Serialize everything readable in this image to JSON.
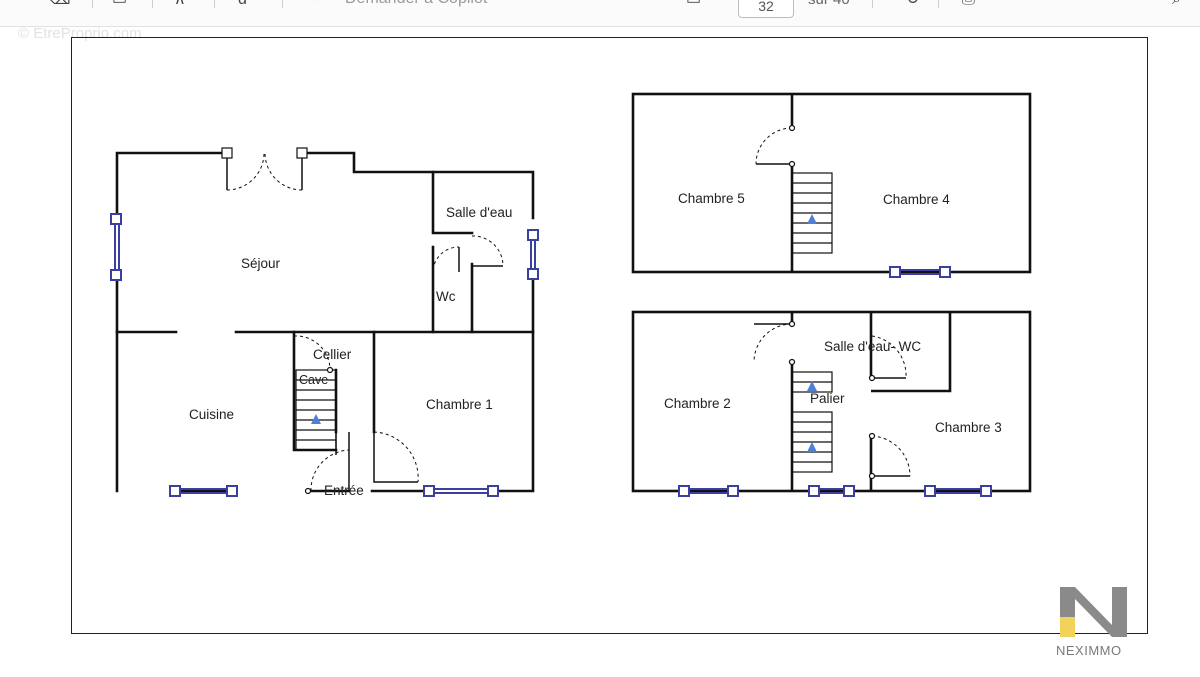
{
  "toolbar": {
    "copilot_label": "Demander à Copilot",
    "current_page": "32",
    "page_total": "sur 40",
    "icons": [
      "eraser-icon",
      "text-box-icon",
      "highlight-icon",
      "read-aloud-icon",
      "copilot-icon",
      "zoom-out-icon",
      "fit-page-icon",
      "rotate-icon",
      "print-icon",
      "search-icon"
    ]
  },
  "watermark": "© EtreProprio.com",
  "rooms": {
    "sejour": "Séjour",
    "salle_eau_rdc": "Salle d'eau",
    "wc": "Wc",
    "cellier": "Cellier",
    "cave": "Cave",
    "cuisine": "Cuisine",
    "chambre1": "Chambre 1",
    "entree": "Entrée",
    "chambre5": "Chambre 5",
    "chambre4": "Chambre 4",
    "salle_eau_wc": "Salle d'eau- WC",
    "palier": "Palier",
    "chambre2": "Chambre 2",
    "chambre3": "Chambre 3"
  },
  "logo": {
    "text": "NEXIMMO"
  },
  "colors": {
    "wall": "#111111",
    "window": "#3b3fa0",
    "stair_arrow": "#4f7fd6",
    "logo_gray": "#8a8a8a",
    "logo_yellow": "#f1d25a"
  }
}
